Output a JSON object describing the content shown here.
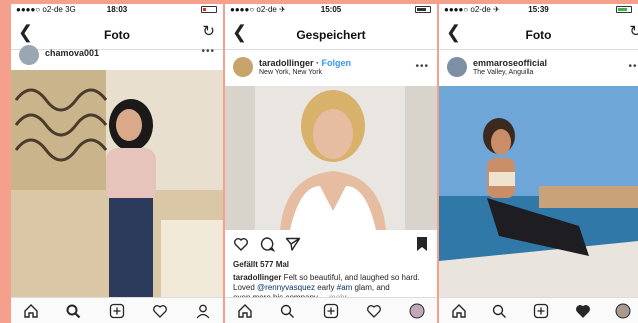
{
  "screens": [
    {
      "status": {
        "carrier": "●●●●○ o2-de  3G",
        "time": "18:03"
      },
      "nav": {
        "title": "Foto"
      },
      "post": {
        "username": "chamova001"
      }
    },
    {
      "status": {
        "carrier": "●●●●○ o2-de ✈",
        "time": "15:05"
      },
      "nav": {
        "title": "Gespeichert"
      },
      "post": {
        "username": "taradollinger",
        "separator": " · ",
        "follow": "Folgen",
        "location": "New York, New York",
        "likes": "Gefällt 577 Mal",
        "caption_user": "taradollinger",
        "caption_text_1": " Felt so beautiful, and laughed so hard.  Loved ",
        "caption_tag_1": "@rennyvasquez",
        "caption_text_2": " early ",
        "caption_tag_2": "#am",
        "caption_text_3": " glam, and ",
        "caption_text_4": "even more his company",
        "caption_more": " ... mehr"
      }
    },
    {
      "status": {
        "carrier": "●●●●○ o2-de ✈",
        "time": "15:39"
      },
      "nav": {
        "title": "Foto"
      },
      "post": {
        "username": "emmaroseofficial",
        "location": "The Valley, Anguilla"
      }
    }
  ],
  "colors": {
    "background": "#f4a08c",
    "link": "#3897f0",
    "tag": "#003569"
  },
  "icons": {
    "tabbar": [
      "home-icon",
      "search-icon",
      "add-icon",
      "heart-icon",
      "profile-icon"
    ],
    "actions": [
      "heart-icon",
      "comment-icon",
      "share-icon",
      "bookmark-icon"
    ]
  }
}
